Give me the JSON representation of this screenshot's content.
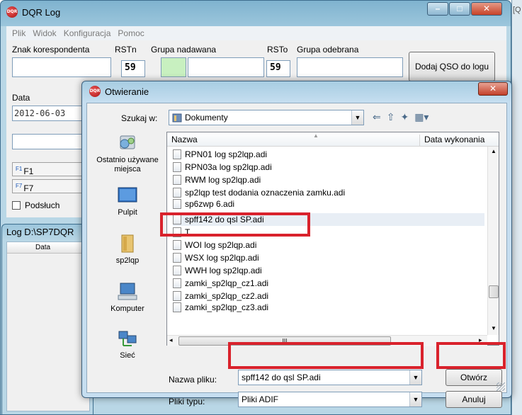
{
  "main_window": {
    "title": "DQR Log",
    "icon_text": "DQR",
    "menu": [
      "Plik",
      "Widok",
      "Konfiguracja",
      "Pomoc"
    ],
    "labels": {
      "callsign": "Znak korespondenta",
      "rst_sent": "RSTn",
      "group_sent": "Grupa nadawana",
      "rst_received": "RSTo",
      "group_received": "Grupa odebrana",
      "date": "Data"
    },
    "values": {
      "rst_sent": "59",
      "rst_received": "59",
      "date": "2012-06-03"
    },
    "add_button": "Dodaj QSO do logu",
    "fkeys": [
      {
        "key": "F1",
        "label": "F1"
      },
      {
        "key": "F7",
        "label": "F7"
      }
    ],
    "listen_label": "Podsłuch"
  },
  "log_window": {
    "title": "Log D:\\SP7DQR",
    "column": "Data"
  },
  "right_window": {
    "title": "[Q"
  },
  "dialog": {
    "title": "Otwieranie",
    "look_in_label": "Szukaj w:",
    "look_in_value": "Dokumenty",
    "places": [
      {
        "label": "Ostatnio używane miejsca",
        "icon": "recent-places-icon"
      },
      {
        "label": "Pulpit",
        "icon": "desktop-icon"
      },
      {
        "label": "sp2lqp",
        "icon": "user-folder-icon"
      },
      {
        "label": "Komputer",
        "icon": "computer-icon"
      },
      {
        "label": "Sieć",
        "icon": "network-icon"
      }
    ],
    "columns": {
      "name": "Nazwa",
      "date": "Data wykonania"
    },
    "files": [
      "RPN01 log sp2lqp.adi",
      "RPN03a log sp2lqp.adi",
      "RWM log sp2lqp.adi",
      "sp2lqp test dodania oznaczenia zamku.adi",
      "sp6zwp 6.adi",
      "spff142 do qsl SP.adi",
      "T",
      "WOI log sp2lqp.adi",
      "WSX log sp2lqp.adi",
      "WWH log sp2lqp.adi",
      "zamki_sp2lqp_cz1.adi",
      "zamki_sp2lqp_cz2.adi",
      "zamki_sp2lqp_cz3.adi"
    ],
    "filename_label": "Nazwa pliku:",
    "filename_value": "spff142 do qsl SP.adi",
    "filetype_label": "Pliki typu:",
    "filetype_value": "Pliki ADIF",
    "open_button": "Otwórz",
    "cancel_button": "Anuluj",
    "hscroll_glyph": "III"
  },
  "colors": {
    "highlight": "#d9222c",
    "title_bar": "#9cc6dc"
  }
}
